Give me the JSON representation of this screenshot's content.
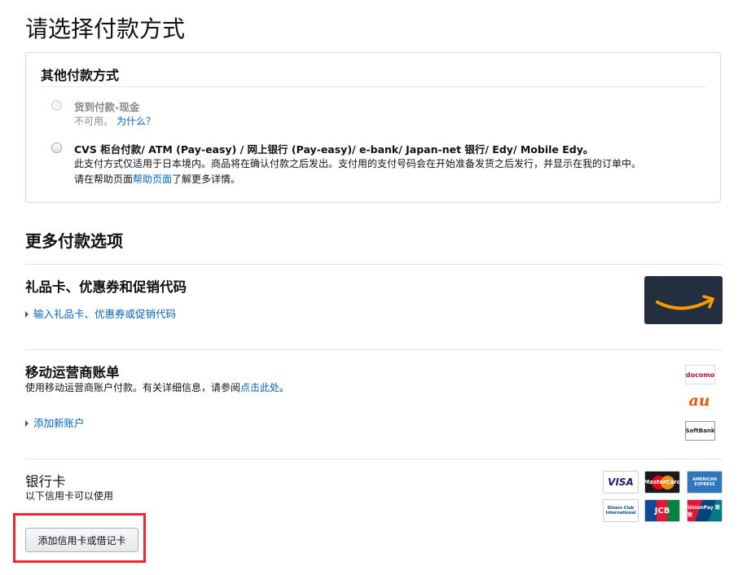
{
  "page": {
    "title": "请选择付款方式"
  },
  "other_methods": {
    "title": "其他付款方式",
    "cod": {
      "label": "货到付款-现金",
      "unavailable": "不可用。",
      "why_link": "为什么？"
    },
    "cvs": {
      "label": "CVS 柜台付款/ ATM (Pay-easy) / 网上银行 (Pay-easy)/ e-bank/ Japan-net 银行/ Edy/ Mobile Edy。",
      "desc1": "此支付方式仅适用于日本境内。商品将在确认付款之后发出。支付用的支付号码会在开始准备发货之后发行，并显示在我的订单中。",
      "desc2_prefix": "请在帮助页面",
      "help_link": "帮助页面",
      "desc2_suffix": "了解更多详情。"
    }
  },
  "more_options": {
    "title": "更多付款选项",
    "gift": {
      "title": "礼品卡、优惠券和促销代码",
      "link": "输入礼品卡、优惠券或促销代码",
      "logo_icon": "amazon-smile-logo"
    },
    "carrier": {
      "title": "移动运营商账单",
      "desc_prefix": "使用移动运营商账户付款。有关详细信息，请参阅",
      "desc_link": "点击此处",
      "desc_suffix": "。",
      "link": "添加新账户",
      "logos": [
        "docomo",
        "au",
        "SoftBank"
      ]
    },
    "bank": {
      "title": "银行卡",
      "desc": "以下信用卡可以使用",
      "add_button": "添加信用卡或借记卡",
      "cards": [
        "VISA",
        "MasterCard",
        "AMERICAN EXPRESS",
        "Diners Club International",
        "JCB",
        "UnionPay 银联"
      ]
    }
  },
  "colors": {
    "link": "#0066c0",
    "highlight": "#f0262e",
    "amazon_bg": "#232f3e",
    "amazon_orange": "#ff9900"
  }
}
